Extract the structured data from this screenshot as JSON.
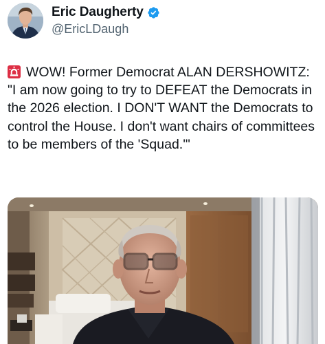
{
  "author": {
    "display_name": "Eric Daugherty",
    "handle": "@EricLDaugh",
    "verified_icon": "verified-badge-icon",
    "avatar": "author-avatar"
  },
  "tweet": {
    "emoji_icon": "police-siren-icon",
    "text": "WOW! Former Democrat ALAN DERSHOWITZ: \"I am now going to try to DEFEAT the Democrats in the 2026 election. I DON'T WANT the Democrats to control the House. I don't want chairs of committees to be members of the 'Squad.'\""
  },
  "media": {
    "kind": "video-still",
    "subject": "elderly man in glasses speaking in a hotel room"
  },
  "colors": {
    "text": "#0f1419",
    "secondary_text": "#536471",
    "verified_blue": "#1d9bf0"
  }
}
